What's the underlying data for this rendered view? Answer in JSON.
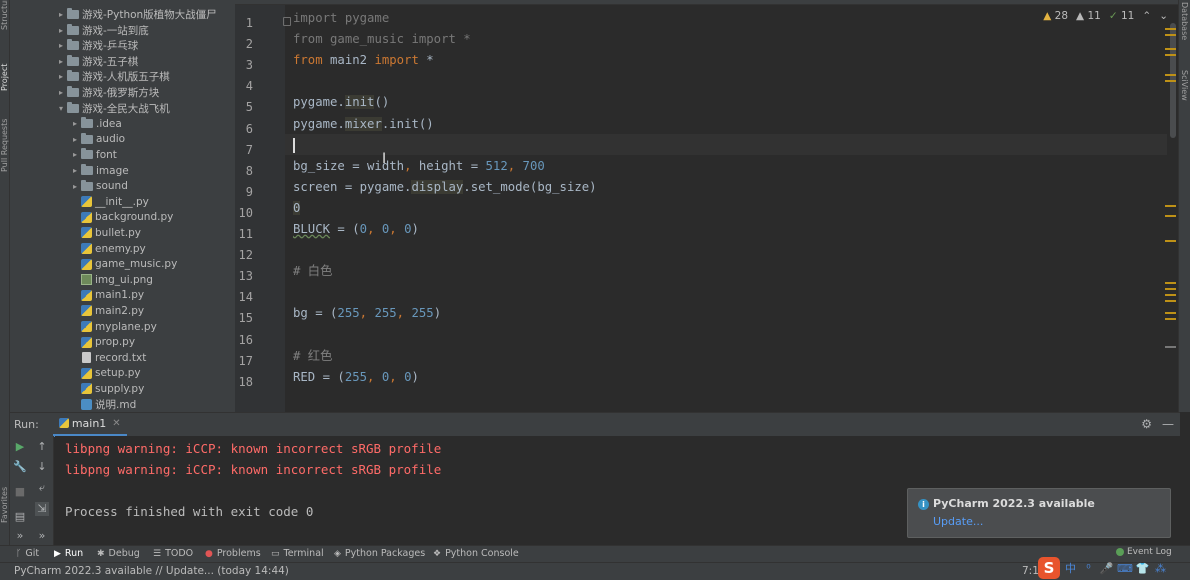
{
  "tool_strip": {
    "project": "Project",
    "structure": "Structure",
    "pull_requests": "Pull Requests",
    "favorites": "Favorites",
    "database": "Database",
    "sciview": "SciView"
  },
  "project_tree": [
    {
      "label": "游戏-Python版植物大战僵尸",
      "kind": "folder",
      "level": 1,
      "expanded": false
    },
    {
      "label": "游戏-一站到底",
      "kind": "folder",
      "level": 1,
      "expanded": false
    },
    {
      "label": "游戏-乒乓球",
      "kind": "folder",
      "level": 1,
      "expanded": false
    },
    {
      "label": "游戏-五子棋",
      "kind": "folder",
      "level": 1,
      "expanded": false
    },
    {
      "label": "游戏-人机版五子棋",
      "kind": "folder",
      "level": 1,
      "expanded": false
    },
    {
      "label": "游戏-俄罗斯方块",
      "kind": "folder",
      "level": 1,
      "expanded": false
    },
    {
      "label": "游戏-全民大战飞机",
      "kind": "folder",
      "level": 1,
      "expanded": true
    },
    {
      "label": ".idea",
      "kind": "folder",
      "level": 2,
      "expanded": false
    },
    {
      "label": "audio",
      "kind": "folder",
      "level": 2,
      "expanded": false
    },
    {
      "label": "font",
      "kind": "folder",
      "level": 2,
      "expanded": false
    },
    {
      "label": "image",
      "kind": "folder",
      "level": 2,
      "expanded": false
    },
    {
      "label": "sound",
      "kind": "folder",
      "level": 2,
      "expanded": false
    },
    {
      "label": "__init__.py",
      "kind": "py",
      "level": 2
    },
    {
      "label": "background.py",
      "kind": "py",
      "level": 2
    },
    {
      "label": "bullet.py",
      "kind": "py",
      "level": 2
    },
    {
      "label": "enemy.py",
      "kind": "py",
      "level": 2
    },
    {
      "label": "game_music.py",
      "kind": "py",
      "level": 2
    },
    {
      "label": "img_ui.png",
      "kind": "img",
      "level": 2
    },
    {
      "label": "main1.py",
      "kind": "py",
      "level": 2
    },
    {
      "label": "main2.py",
      "kind": "py",
      "level": 2
    },
    {
      "label": "myplane.py",
      "kind": "py",
      "level": 2
    },
    {
      "label": "prop.py",
      "kind": "py",
      "level": 2
    },
    {
      "label": "record.txt",
      "kind": "txt",
      "level": 2
    },
    {
      "label": "setup.py",
      "kind": "py",
      "level": 2
    },
    {
      "label": "supply.py",
      "kind": "py",
      "level": 2
    },
    {
      "label": "说明.md",
      "kind": "md",
      "level": 2
    }
  ],
  "inspections": {
    "warnings": "28",
    "weak_warnings": "11",
    "ok": "11"
  },
  "editor": {
    "line_numbers": [
      "1",
      "2",
      "3",
      "4",
      "5",
      "6",
      "7",
      "8",
      "9",
      "10",
      "11",
      "12",
      "13",
      "14",
      "15",
      "16",
      "17",
      "18"
    ],
    "lines": [
      [
        {
          "t": "import pygame",
          "c": "dim"
        }
      ],
      [
        {
          "t": "from ",
          "c": "dim"
        },
        {
          "t": "game_music ",
          "c": "dim"
        },
        {
          "t": "import ",
          "c": "dim"
        },
        {
          "t": "*",
          "c": "dim"
        }
      ],
      [
        {
          "t": "from ",
          "c": "kw"
        },
        {
          "t": "main2 ",
          "c": ""
        },
        {
          "t": "import ",
          "c": "kw"
        },
        {
          "t": "*",
          "c": ""
        }
      ],
      [],
      [
        {
          "t": "pygame.",
          "c": ""
        },
        {
          "t": "init",
          "c": "hl"
        },
        {
          "t": "()",
          "c": ""
        }
      ],
      [
        {
          "t": "pygame.",
          "c": ""
        },
        {
          "t": "mixer",
          "c": "hl"
        },
        {
          "t": ".init()",
          "c": ""
        }
      ],
      [
        {
          "t": "",
          "c": "caret"
        }
      ],
      [
        {
          "t": "bg_size = width",
          "c": ""
        },
        {
          "t": ", ",
          "c": "kw"
        },
        {
          "t": "height = ",
          "c": ""
        },
        {
          "t": "512",
          "c": "num"
        },
        {
          "t": ", ",
          "c": "kw"
        },
        {
          "t": "700",
          "c": "num"
        }
      ],
      [
        {
          "t": "screen = pygame.",
          "c": ""
        },
        {
          "t": "display",
          "c": "hl"
        },
        {
          "t": ".set_mode(bg_size)",
          "c": ""
        }
      ],
      [
        {
          "t": "0",
          "c": "hl num"
        }
      ],
      [
        {
          "t": "BLUCK",
          "c": "squig"
        },
        {
          "t": " = (",
          "c": ""
        },
        {
          "t": "0",
          "c": "num"
        },
        {
          "t": ", ",
          "c": "kw"
        },
        {
          "t": "0",
          "c": "num"
        },
        {
          "t": ", ",
          "c": "kw"
        },
        {
          "t": "0",
          "c": "num"
        },
        {
          "t": ")",
          "c": ""
        }
      ],
      [],
      [
        {
          "t": "# 白色",
          "c": "cm"
        }
      ],
      [],
      [
        {
          "t": "bg = (",
          "c": ""
        },
        {
          "t": "255",
          "c": "num"
        },
        {
          "t": ", ",
          "c": "kw"
        },
        {
          "t": "255",
          "c": "num"
        },
        {
          "t": ", ",
          "c": "kw"
        },
        {
          "t": "255",
          "c": "num"
        },
        {
          "t": ")",
          "c": ""
        }
      ],
      [],
      [
        {
          "t": "# 红色",
          "c": "cm"
        }
      ],
      [
        {
          "t": "RED = (",
          "c": ""
        },
        {
          "t": "255",
          "c": "num"
        },
        {
          "t": ", ",
          "c": "kw"
        },
        {
          "t": "0",
          "c": "num"
        },
        {
          "t": ", ",
          "c": "kw"
        },
        {
          "t": "0",
          "c": "num"
        },
        {
          "t": ")",
          "c": ""
        }
      ]
    ]
  },
  "run_panel": {
    "label": "Run:",
    "tab": "main1",
    "console": [
      {
        "text": "libpng warning: iCCP: known incorrect sRGB profile",
        "kind": "err"
      },
      {
        "text": "libpng warning: iCCP: known incorrect sRGB profile",
        "kind": "err"
      },
      {
        "text": "",
        "kind": "plain"
      },
      {
        "text": "Process finished with exit code 0",
        "kind": "plain"
      }
    ]
  },
  "notification": {
    "title": "PyCharm 2022.3 available",
    "link": "Update..."
  },
  "tool_tabs": [
    "Git",
    "Run",
    "Debug",
    "TODO",
    "Problems",
    "Terminal",
    "Python Packages",
    "Python Console"
  ],
  "event_log": "Event Log",
  "status": {
    "message": "PyCharm 2022.3 available // Update... (today 14:44)",
    "position": "7:1"
  },
  "tray": {
    "sogou": "S",
    "ime_mode": "中"
  },
  "colors": {
    "accent": "#4a88c7",
    "error": "#ff6b68",
    "keyword": "#cc7832",
    "number": "#6897bb",
    "comment": "#808080",
    "link": "#589df6"
  }
}
